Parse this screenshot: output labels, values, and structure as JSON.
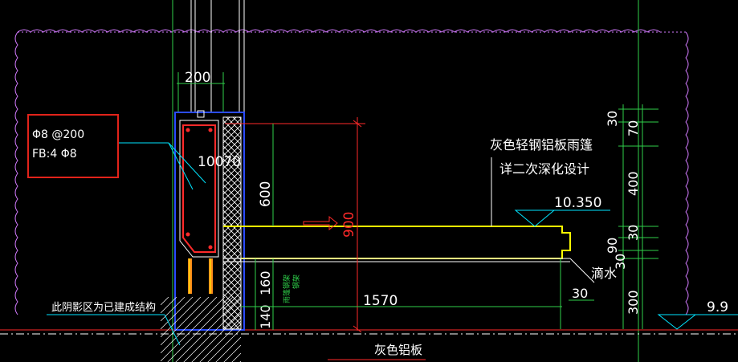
{
  "texts": {
    "rebar_spec": "Φ8 @200",
    "fb_spec": "FB:4 Φ8",
    "dim_200": "200",
    "dim_10070": "10070",
    "dim_600": "600",
    "dim_900": "900",
    "dim_160": "160",
    "dim_140": "140",
    "dim_1570": "1570",
    "dim_30_drip": "30",
    "canopy_label": "灰色轻钢铝板雨篷",
    "design_note": "详二次深化设计",
    "elev_10350": "10.350",
    "drip_label": "滴水",
    "existing_note": "此阴影区为已建成结构",
    "bottom_label": "灰色铝板",
    "elev_99": "9.9",
    "small_vertical_label": "雨篷钢架",
    "small_label_2": "钢架",
    "right_dims": [
      "30",
      "70",
      "400",
      "30",
      "90",
      "30",
      "300"
    ]
  },
  "colors": {
    "background": "#000000",
    "white": "#ffffff",
    "cyan": "#00e5ff",
    "yellow": "#ffff00",
    "red": "#ff2a2a",
    "orange": "#ff8c1a",
    "green": "#2fd14a",
    "blue": "#2b4cff",
    "magenta": "#d47bff",
    "highlight": "#e2231a"
  }
}
